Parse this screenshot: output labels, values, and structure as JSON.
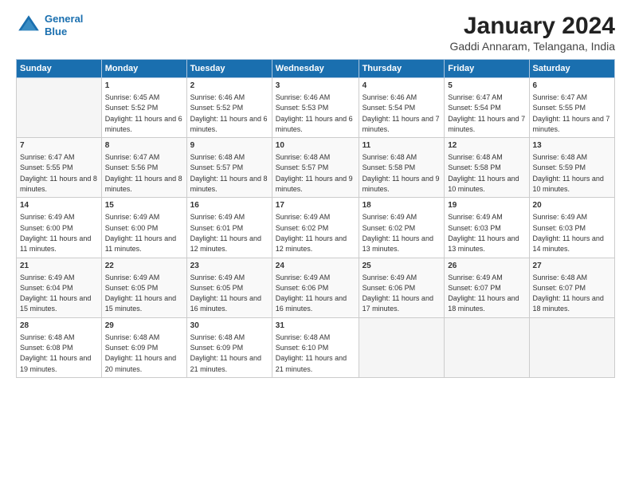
{
  "logo": {
    "line1": "General",
    "line2": "Blue"
  },
  "title": "January 2024",
  "subtitle": "Gaddi Annaram, Telangana, India",
  "weekdays": [
    "Sunday",
    "Monday",
    "Tuesday",
    "Wednesday",
    "Thursday",
    "Friday",
    "Saturday"
  ],
  "weeks": [
    [
      {
        "day": "",
        "sunrise": "",
        "sunset": "",
        "daylight": ""
      },
      {
        "day": "1",
        "sunrise": "Sunrise: 6:45 AM",
        "sunset": "Sunset: 5:52 PM",
        "daylight": "Daylight: 11 hours and 6 minutes."
      },
      {
        "day": "2",
        "sunrise": "Sunrise: 6:46 AM",
        "sunset": "Sunset: 5:52 PM",
        "daylight": "Daylight: 11 hours and 6 minutes."
      },
      {
        "day": "3",
        "sunrise": "Sunrise: 6:46 AM",
        "sunset": "Sunset: 5:53 PM",
        "daylight": "Daylight: 11 hours and 6 minutes."
      },
      {
        "day": "4",
        "sunrise": "Sunrise: 6:46 AM",
        "sunset": "Sunset: 5:54 PM",
        "daylight": "Daylight: 11 hours and 7 minutes."
      },
      {
        "day": "5",
        "sunrise": "Sunrise: 6:47 AM",
        "sunset": "Sunset: 5:54 PM",
        "daylight": "Daylight: 11 hours and 7 minutes."
      },
      {
        "day": "6",
        "sunrise": "Sunrise: 6:47 AM",
        "sunset": "Sunset: 5:55 PM",
        "daylight": "Daylight: 11 hours and 7 minutes."
      }
    ],
    [
      {
        "day": "7",
        "sunrise": "Sunrise: 6:47 AM",
        "sunset": "Sunset: 5:55 PM",
        "daylight": "Daylight: 11 hours and 8 minutes."
      },
      {
        "day": "8",
        "sunrise": "Sunrise: 6:47 AM",
        "sunset": "Sunset: 5:56 PM",
        "daylight": "Daylight: 11 hours and 8 minutes."
      },
      {
        "day": "9",
        "sunrise": "Sunrise: 6:48 AM",
        "sunset": "Sunset: 5:57 PM",
        "daylight": "Daylight: 11 hours and 8 minutes."
      },
      {
        "day": "10",
        "sunrise": "Sunrise: 6:48 AM",
        "sunset": "Sunset: 5:57 PM",
        "daylight": "Daylight: 11 hours and 9 minutes."
      },
      {
        "day": "11",
        "sunrise": "Sunrise: 6:48 AM",
        "sunset": "Sunset: 5:58 PM",
        "daylight": "Daylight: 11 hours and 9 minutes."
      },
      {
        "day": "12",
        "sunrise": "Sunrise: 6:48 AM",
        "sunset": "Sunset: 5:58 PM",
        "daylight": "Daylight: 11 hours and 10 minutes."
      },
      {
        "day": "13",
        "sunrise": "Sunrise: 6:48 AM",
        "sunset": "Sunset: 5:59 PM",
        "daylight": "Daylight: 11 hours and 10 minutes."
      }
    ],
    [
      {
        "day": "14",
        "sunrise": "Sunrise: 6:49 AM",
        "sunset": "Sunset: 6:00 PM",
        "daylight": "Daylight: 11 hours and 11 minutes."
      },
      {
        "day": "15",
        "sunrise": "Sunrise: 6:49 AM",
        "sunset": "Sunset: 6:00 PM",
        "daylight": "Daylight: 11 hours and 11 minutes."
      },
      {
        "day": "16",
        "sunrise": "Sunrise: 6:49 AM",
        "sunset": "Sunset: 6:01 PM",
        "daylight": "Daylight: 11 hours and 12 minutes."
      },
      {
        "day": "17",
        "sunrise": "Sunrise: 6:49 AM",
        "sunset": "Sunset: 6:02 PM",
        "daylight": "Daylight: 11 hours and 12 minutes."
      },
      {
        "day": "18",
        "sunrise": "Sunrise: 6:49 AM",
        "sunset": "Sunset: 6:02 PM",
        "daylight": "Daylight: 11 hours and 13 minutes."
      },
      {
        "day": "19",
        "sunrise": "Sunrise: 6:49 AM",
        "sunset": "Sunset: 6:03 PM",
        "daylight": "Daylight: 11 hours and 13 minutes."
      },
      {
        "day": "20",
        "sunrise": "Sunrise: 6:49 AM",
        "sunset": "Sunset: 6:03 PM",
        "daylight": "Daylight: 11 hours and 14 minutes."
      }
    ],
    [
      {
        "day": "21",
        "sunrise": "Sunrise: 6:49 AM",
        "sunset": "Sunset: 6:04 PM",
        "daylight": "Daylight: 11 hours and 15 minutes."
      },
      {
        "day": "22",
        "sunrise": "Sunrise: 6:49 AM",
        "sunset": "Sunset: 6:05 PM",
        "daylight": "Daylight: 11 hours and 15 minutes."
      },
      {
        "day": "23",
        "sunrise": "Sunrise: 6:49 AM",
        "sunset": "Sunset: 6:05 PM",
        "daylight": "Daylight: 11 hours and 16 minutes."
      },
      {
        "day": "24",
        "sunrise": "Sunrise: 6:49 AM",
        "sunset": "Sunset: 6:06 PM",
        "daylight": "Daylight: 11 hours and 16 minutes."
      },
      {
        "day": "25",
        "sunrise": "Sunrise: 6:49 AM",
        "sunset": "Sunset: 6:06 PM",
        "daylight": "Daylight: 11 hours and 17 minutes."
      },
      {
        "day": "26",
        "sunrise": "Sunrise: 6:49 AM",
        "sunset": "Sunset: 6:07 PM",
        "daylight": "Daylight: 11 hours and 18 minutes."
      },
      {
        "day": "27",
        "sunrise": "Sunrise: 6:48 AM",
        "sunset": "Sunset: 6:07 PM",
        "daylight": "Daylight: 11 hours and 18 minutes."
      }
    ],
    [
      {
        "day": "28",
        "sunrise": "Sunrise: 6:48 AM",
        "sunset": "Sunset: 6:08 PM",
        "daylight": "Daylight: 11 hours and 19 minutes."
      },
      {
        "day": "29",
        "sunrise": "Sunrise: 6:48 AM",
        "sunset": "Sunset: 6:09 PM",
        "daylight": "Daylight: 11 hours and 20 minutes."
      },
      {
        "day": "30",
        "sunrise": "Sunrise: 6:48 AM",
        "sunset": "Sunset: 6:09 PM",
        "daylight": "Daylight: 11 hours and 21 minutes."
      },
      {
        "day": "31",
        "sunrise": "Sunrise: 6:48 AM",
        "sunset": "Sunset: 6:10 PM",
        "daylight": "Daylight: 11 hours and 21 minutes."
      },
      {
        "day": "",
        "sunrise": "",
        "sunset": "",
        "daylight": ""
      },
      {
        "day": "",
        "sunrise": "",
        "sunset": "",
        "daylight": ""
      },
      {
        "day": "",
        "sunrise": "",
        "sunset": "",
        "daylight": ""
      }
    ]
  ]
}
